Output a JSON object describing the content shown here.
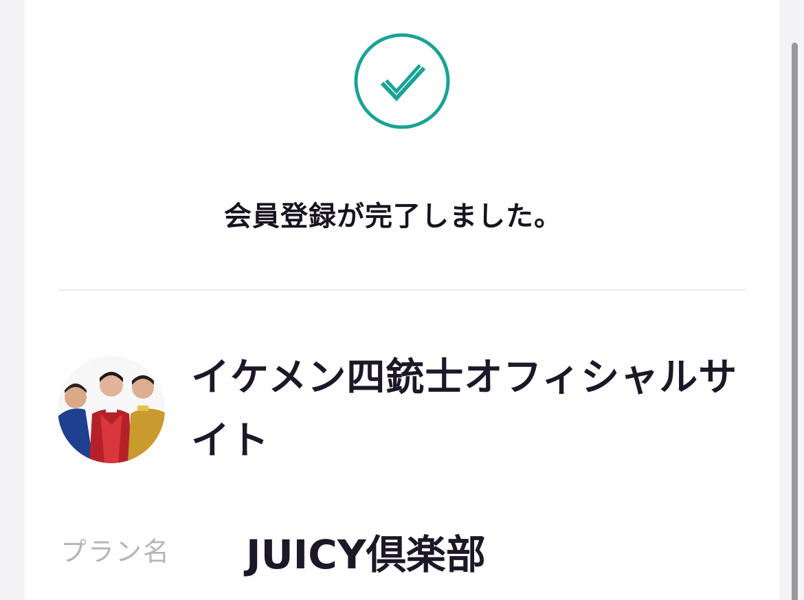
{
  "status": {
    "icon": "checkmark-circle-icon",
    "message": "会員登録が完了しました。"
  },
  "site": {
    "avatar": "group-photo-avatar",
    "name": "イケメン四銃士オフィシャルサイト"
  },
  "plan": {
    "label": "プラン名",
    "value": "JUICY倶楽部"
  },
  "colors": {
    "accent": "#19a394",
    "text_primary": "#1c1827",
    "text_muted": "#b5b3bb",
    "divider": "#ececef",
    "background": "#f4f4f6"
  }
}
